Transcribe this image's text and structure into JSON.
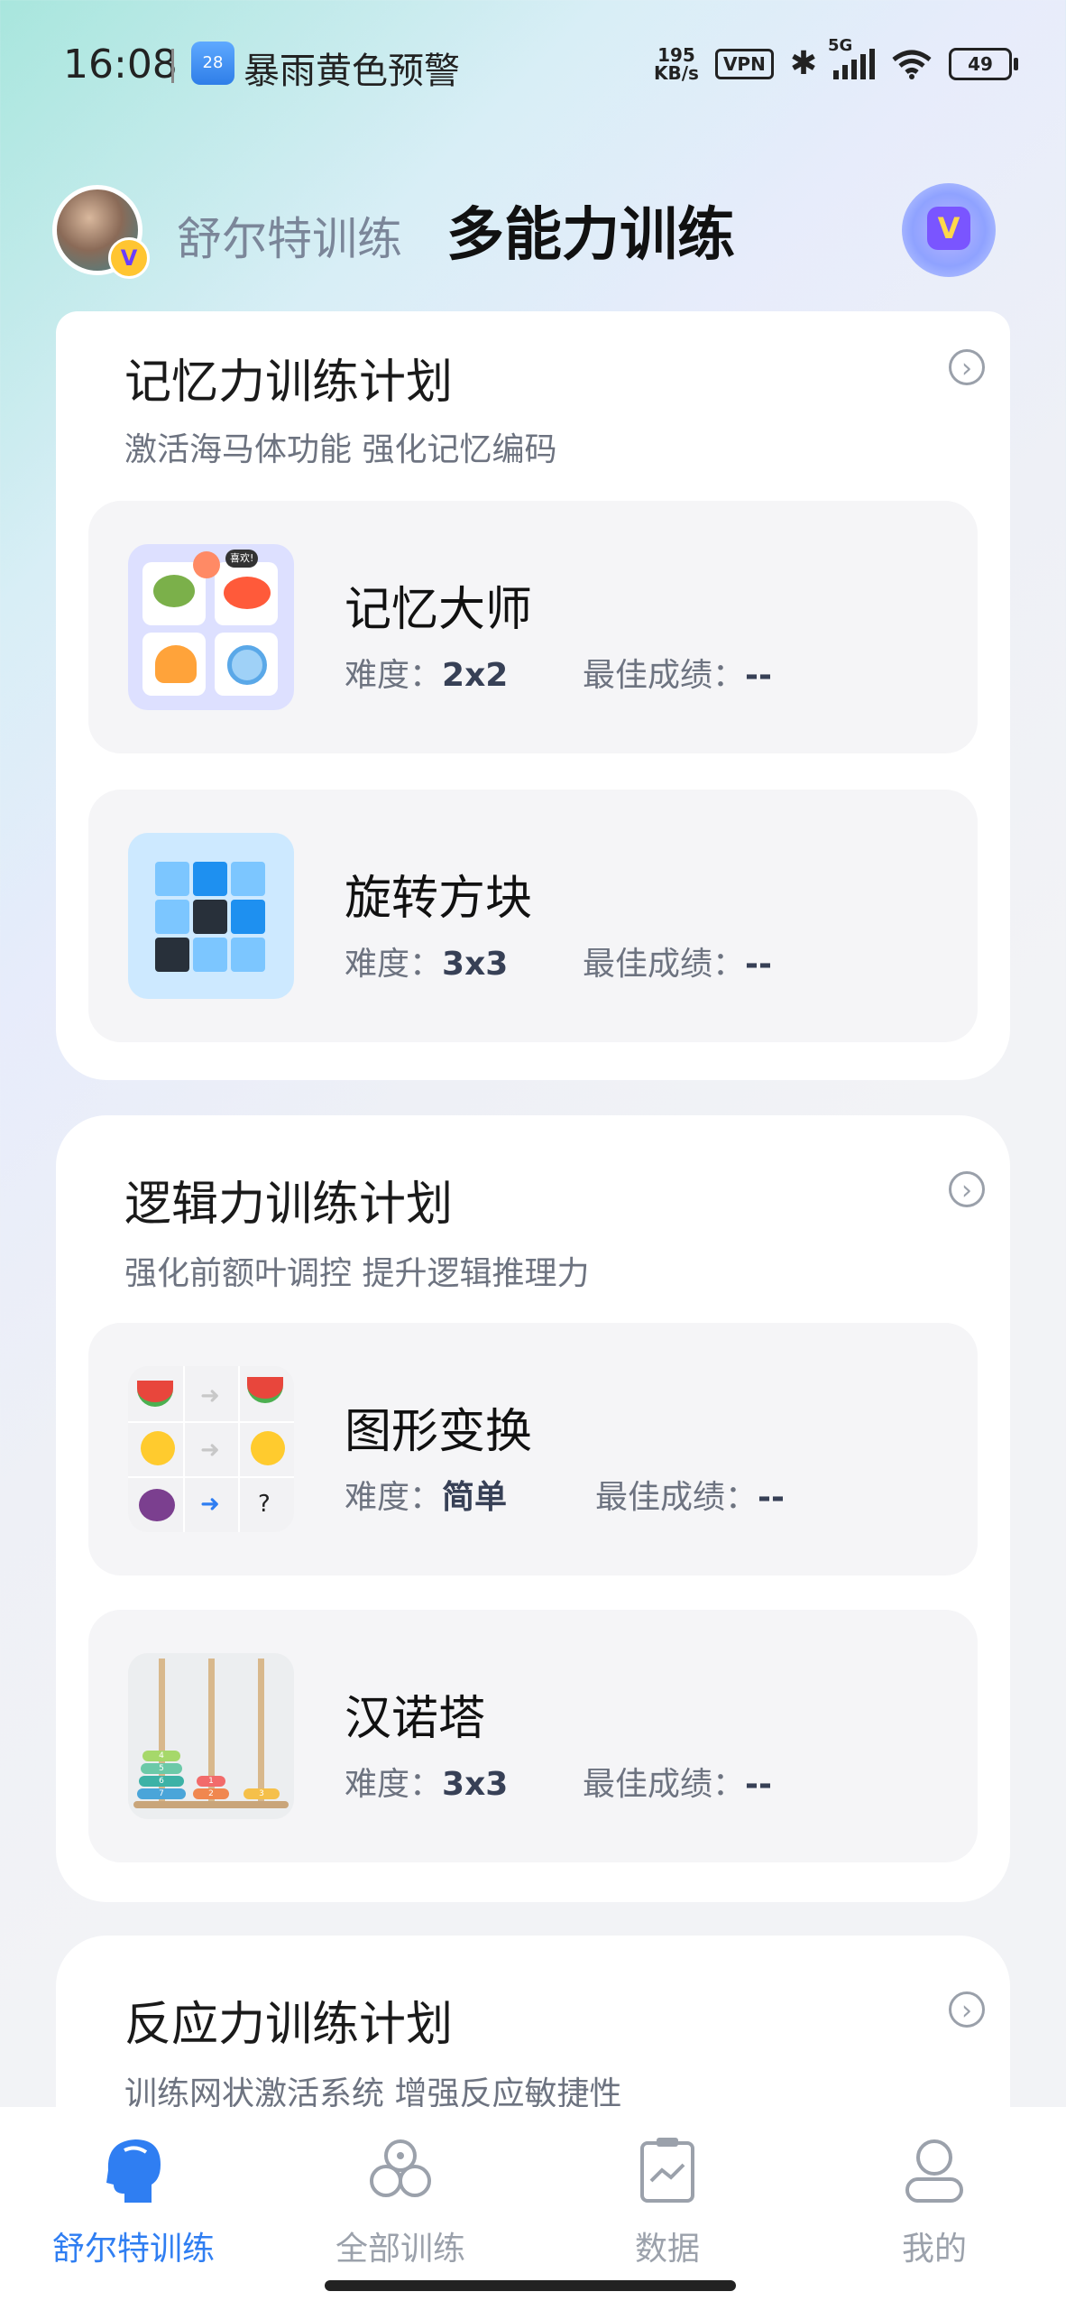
{
  "status_bar": {
    "time": "16:08",
    "weather_badge": "28",
    "alert": "暴雨黄色预警",
    "speed_value": "195",
    "speed_unit": "KB/s",
    "vpn": "VPN",
    "network": "5G",
    "battery": "49"
  },
  "header": {
    "tab_inactive": "舒尔特训练",
    "tab_active": "多能力训练"
  },
  "plans": [
    {
      "title": "记忆力训练计划",
      "subtitle": "激活海马体功能  强化记忆编码",
      "items": [
        {
          "name": "记忆大师",
          "difficulty_label": "难度：",
          "difficulty": "2x2",
          "best_label": "最佳成绩：",
          "best": "--"
        },
        {
          "name": "旋转方块",
          "difficulty_label": "难度：",
          "difficulty": "3x3",
          "best_label": "最佳成绩：",
          "best": "--"
        }
      ]
    },
    {
      "title": "逻辑力训练计划",
      "subtitle": "强化前额叶调控  提升逻辑推理力",
      "items": [
        {
          "name": "图形变换",
          "difficulty_label": "难度：",
          "difficulty": "简单",
          "best_label": "最佳成绩：",
          "best": "--"
        },
        {
          "name": "汉诺塔",
          "difficulty_label": "难度：",
          "difficulty": "3x3",
          "best_label": "最佳成绩：",
          "best": "--"
        }
      ]
    },
    {
      "title": "反应力训练计划",
      "subtitle": "训练网状激活系统  增强反应敏捷性",
      "items": []
    }
  ],
  "thumb_text": {
    "memory_bubble": "喜欢!",
    "shape_question": "?",
    "hanoi_left_numbers": [
      "4",
      "5",
      "6",
      "7"
    ],
    "hanoi_mid_numbers": [
      "1",
      "2"
    ],
    "hanoi_right_numbers": [
      "3"
    ]
  },
  "bottom_nav": [
    {
      "label": "舒尔特训练",
      "icon": "brain-head-icon",
      "active": true
    },
    {
      "label": "全部训练",
      "icon": "all-training-icon",
      "active": false
    },
    {
      "label": "数据",
      "icon": "data-clipboard-icon",
      "active": false
    },
    {
      "label": "我的",
      "icon": "profile-icon",
      "active": false
    }
  ],
  "colors": {
    "accent": "#2f7ef2",
    "card_bg": "#ffffff",
    "item_bg": "#f5f5f7",
    "subtitle": "#6d7380"
  }
}
